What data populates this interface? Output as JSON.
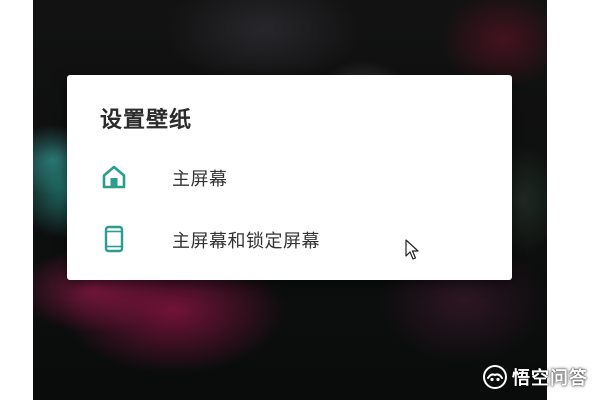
{
  "dialog": {
    "title": "设置壁纸",
    "options": [
      {
        "label": "主屏幕",
        "icon": "home-icon"
      },
      {
        "label": "主屏幕和锁定屏幕",
        "icon": "phone-icon"
      }
    ]
  },
  "watermark": {
    "text": "悟空问答",
    "icon": "wukong-logo-icon"
  },
  "colors": {
    "accent": "#2a9d8f",
    "dialog_bg": "#ffffff",
    "text_primary": "#2b2b2b"
  }
}
